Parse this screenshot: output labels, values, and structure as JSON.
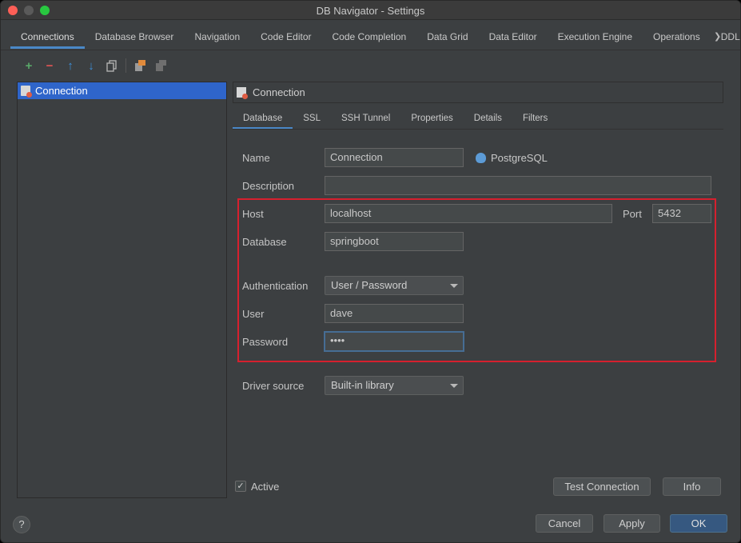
{
  "window": {
    "title": "DB Navigator - Settings"
  },
  "tabs": [
    {
      "label": "Connections"
    },
    {
      "label": "Database Browser"
    },
    {
      "label": "Navigation"
    },
    {
      "label": "Code Editor"
    },
    {
      "label": "Code Completion"
    },
    {
      "label": "Data Grid"
    },
    {
      "label": "Data Editor"
    },
    {
      "label": "Execution Engine"
    },
    {
      "label": "Operations"
    },
    {
      "label": "DDL Files"
    }
  ],
  "toolbar": {
    "add_icon": "+",
    "remove_icon": "−",
    "up_icon": "↑",
    "down_icon": "↓",
    "colors": {
      "add": "#59a869",
      "remove": "#e05555",
      "arrows": "#3d8fd9"
    }
  },
  "tree": {
    "items": [
      {
        "label": "Connection"
      }
    ]
  },
  "panel": {
    "header": "Connection",
    "subtabs": [
      {
        "label": "Database"
      },
      {
        "label": "SSL"
      },
      {
        "label": "SSH Tunnel"
      },
      {
        "label": "Properties"
      },
      {
        "label": "Details"
      },
      {
        "label": "Filters"
      }
    ]
  },
  "form": {
    "name_label": "Name",
    "name_value": "Connection",
    "db_type": "PostgreSQL",
    "description_label": "Description",
    "description_value": "",
    "host_label": "Host",
    "host_value": "localhost",
    "port_label": "Port",
    "port_value": "5432",
    "database_label": "Database",
    "database_value": "springboot",
    "auth_label": "Authentication",
    "auth_value": "User / Password",
    "user_label": "User",
    "user_value": "dave",
    "password_label": "Password",
    "password_value": "••••",
    "driver_label": "Driver source",
    "driver_value": "Built-in library"
  },
  "footer": {
    "active_label": "Active",
    "active_checked": true,
    "test_connection": "Test Connection",
    "info": "Info",
    "cancel": "Cancel",
    "apply": "Apply",
    "ok": "OK",
    "help": "?"
  },
  "colors": {
    "highlight": "#d6202e",
    "selection": "#2f65ca",
    "accent": "#4a88c7"
  }
}
